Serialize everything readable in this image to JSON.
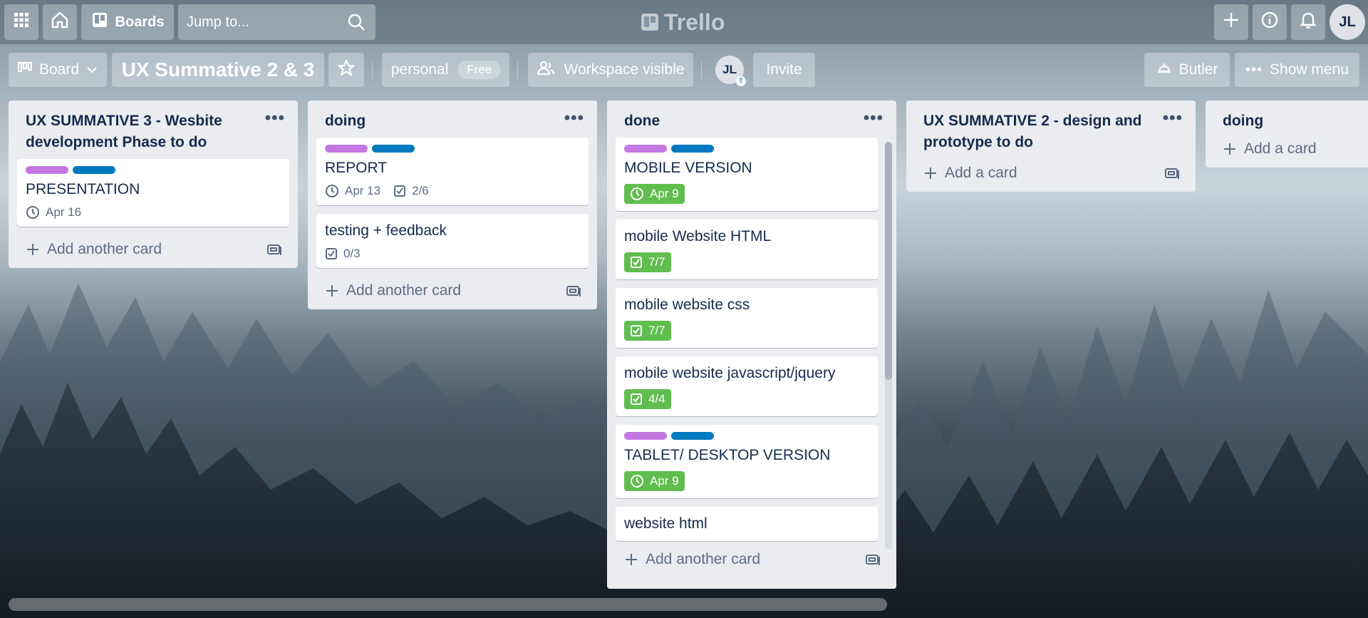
{
  "topbar": {
    "boards_label": "Boards",
    "search_placeholder": "Jump to...",
    "logo_text": "Trello",
    "avatar_initials": "JL"
  },
  "boardbar": {
    "view_label": "Board",
    "board_title": "UX Summative 2 & 3",
    "workspace": "personal",
    "plan_badge": "Free",
    "visibility": "Workspace visible",
    "member_initials": "JL",
    "invite_label": "Invite",
    "butler_label": "Butler",
    "show_menu_label": "Show menu"
  },
  "colors": {
    "label_purple": "#c377e0",
    "label_blue": "#0079bf",
    "badge_green": "#61bd4f"
  },
  "lists": [
    {
      "title": "UX SUMMATIVE 3 - Wesbite development Phase to do",
      "add_label": "Add another card",
      "cards": [
        {
          "labels": [
            "purple",
            "blue"
          ],
          "title": "PRESENTATION",
          "badges": [
            {
              "type": "due",
              "text": "Apr 16"
            }
          ]
        }
      ]
    },
    {
      "title": "doing",
      "add_label": "Add another card",
      "cards": [
        {
          "labels": [
            "purple",
            "blue"
          ],
          "title": "REPORT",
          "badges": [
            {
              "type": "due",
              "text": "Apr 13"
            },
            {
              "type": "check",
              "text": "2/6"
            }
          ]
        },
        {
          "labels": [],
          "title": "testing + feedback",
          "badges": [
            {
              "type": "check",
              "text": "0/3"
            }
          ]
        }
      ]
    },
    {
      "title": "done",
      "add_label": "Add another card",
      "cards": [
        {
          "labels": [
            "purple",
            "blue"
          ],
          "title": "MOBILE VERSION",
          "badges": [
            {
              "type": "due-done",
              "text": "Apr 9"
            }
          ]
        },
        {
          "labels": [],
          "title": "mobile Website HTML",
          "badges": [
            {
              "type": "check-done",
              "text": "7/7"
            }
          ]
        },
        {
          "labels": [],
          "title": "mobile website css",
          "badges": [
            {
              "type": "check-done",
              "text": "7/7"
            }
          ]
        },
        {
          "labels": [],
          "title": "mobile website javascript/jquery",
          "badges": [
            {
              "type": "check-done",
              "text": "4/4"
            }
          ]
        },
        {
          "labels": [
            "purple",
            "blue"
          ],
          "title": "TABLET/ DESKTOP VERSION",
          "badges": [
            {
              "type": "due-done",
              "text": "Apr 9"
            }
          ]
        },
        {
          "labels": [],
          "title": "website html",
          "badges": []
        }
      ]
    },
    {
      "title": "UX SUMMATIVE 2 - design and prototype to do",
      "add_label": "Add a card",
      "cards": []
    },
    {
      "title": "doing",
      "add_label": "Add a card",
      "cards": []
    }
  ]
}
